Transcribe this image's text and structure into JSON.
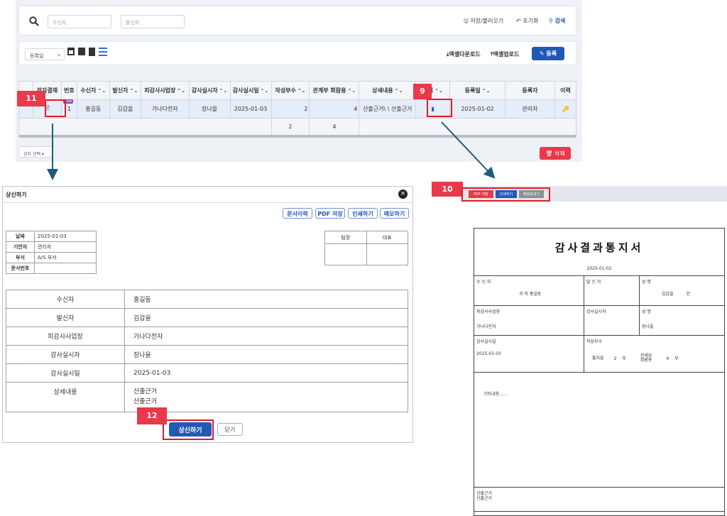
{
  "search": {
    "receiver_placeholder": "수신자",
    "sender_placeholder": "발신자",
    "save_load": "저장/불러오기",
    "reset": "초기화",
    "search": "검색"
  },
  "toolbar": {
    "date_select": "등록일",
    "excel_download": "엑셀다운로드",
    "excel_upload": "엑셀업로드",
    "register": "등록"
  },
  "table": {
    "headers": [
      "전자결재",
      "번호",
      "수신자",
      "발신자",
      "피감사사업장",
      "감사실시자",
      "감사실시일",
      "작성부수",
      "관계부 회람용",
      "상세내용",
      "양식",
      "등록일",
      "등록자",
      "이력"
    ],
    "row": {
      "no": "1",
      "new_badge": "new",
      "receiver": "홍길동",
      "sender": "김갑을",
      "site": "가나다전자",
      "auditor": "장나을",
      "date": "2025-01-03",
      "copies": "2",
      "circ": "4",
      "detail": "산출근거\\ \\ 산출근거",
      "reg_date": "2025-01-02",
      "registrant": "관리자"
    },
    "totals": {
      "copies": "2",
      "circ": "4"
    }
  },
  "footer": {
    "notice_select": "공지 선택",
    "delete": "삭제"
  },
  "callouts": {
    "c9": "9",
    "c10": "10",
    "c11": "11",
    "c12": "12"
  },
  "modal": {
    "title": "상신하기",
    "buttons": {
      "history": "문서이력",
      "pdf": "PDF 저장",
      "print": "인쇄하기",
      "memo": "메모하기"
    },
    "info": [
      {
        "label": "날짜",
        "value": "2025-01-03"
      },
      {
        "label": "기안자",
        "value": "관리자"
      },
      {
        "label": "부서",
        "value": "A/S 부서"
      },
      {
        "label": "문서번호",
        "value": ""
      }
    ],
    "approval": {
      "lead": "팀장",
      "ceo": "대표"
    },
    "fields": [
      {
        "label": "수신자",
        "value": "홍길동"
      },
      {
        "label": "발신자",
        "value": "김갑을"
      },
      {
        "label": "피감사사업장",
        "value": "가나다전자"
      },
      {
        "label": "감사실시자",
        "value": "장나을"
      },
      {
        "label": "감사실시일",
        "value": "2025-01-03"
      }
    ],
    "detail_label": "상세내용",
    "detail_lines": [
      "산출근거",
      "산출근거"
    ],
    "submit": "상신하기",
    "close": "닫기"
  },
  "preview": {
    "pdf": "PDF 저장",
    "print": "인쇄하기",
    "mail": "메일보내기"
  },
  "document": {
    "title": "감사결과통지서",
    "date": "2025-01-02",
    "receiver_label": "수 신 자",
    "receiver_value": "귀 하  홍길동",
    "sender_label": "발 신 자",
    "name_label": "성 명",
    "name_value": "김갑을",
    "seal": "인",
    "site_label": "피감사사업장",
    "site_value": "가나다전자",
    "auditor_label": "감사실시자",
    "name2_label": "성 명",
    "name2_value": "장나을",
    "date_label": "감사실시일",
    "date_value": "2025-01-03",
    "copies_label": "작성부수",
    "notice_label": "통지용",
    "notice_value": "2",
    "unit": "부",
    "circ_label1": "관계부",
    "circ_label2": "회람용",
    "circ_value": "4",
    "etc": "기타내용......",
    "foot_lines": [
      "산출근거",
      "산출근거"
    ]
  }
}
